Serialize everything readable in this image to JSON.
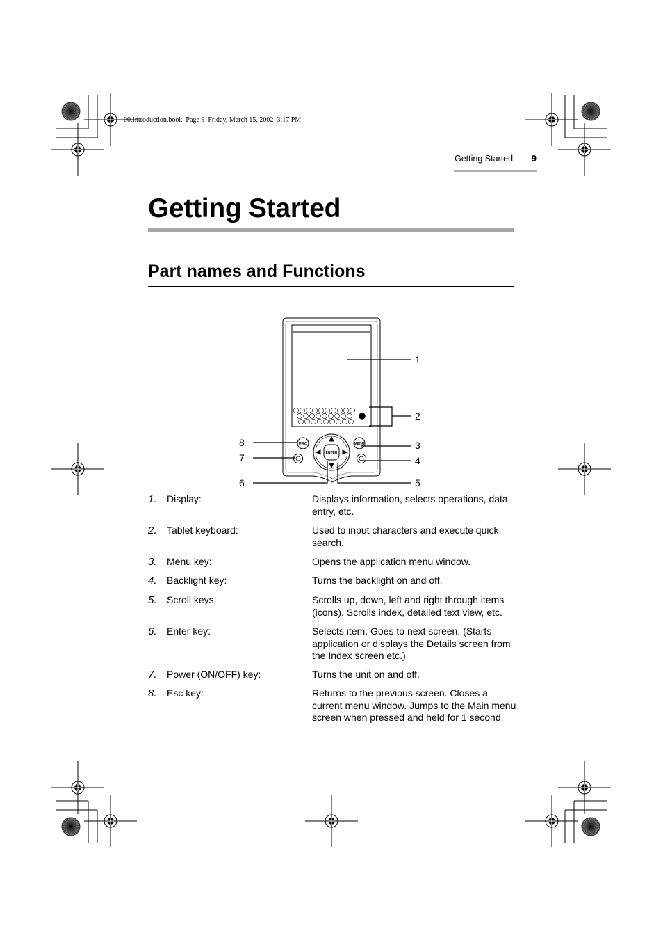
{
  "slug": "00.Introduction.book  Page 9  Friday, March 15, 2002  3:17 PM",
  "running_header": {
    "section": "Getting Started",
    "page_number": "9"
  },
  "title": "Getting Started",
  "subtitle": "Part names and Functions",
  "diagram": {
    "callouts": [
      "1",
      "2",
      "3",
      "4",
      "5",
      "6",
      "7",
      "8"
    ],
    "device_labels": {
      "esc": "ESC",
      "menu": "MENU",
      "enter": "ENTER"
    }
  },
  "items": [
    {
      "num": "1.",
      "label": "Display:",
      "desc": "Displays information, selects operations, data entry, etc."
    },
    {
      "num": "2.",
      "label": "Tablet keyboard:",
      "desc": "Used to input characters and execute quick search."
    },
    {
      "num": "3.",
      "label": "Menu key:",
      "desc": "Opens the application menu window."
    },
    {
      "num": "4.",
      "label": "Backlight key:",
      "desc": "Turns the backlight on and off."
    },
    {
      "num": "5.",
      "label": "Scroll keys:",
      "desc": "Scrolls up, down, left and right through items (icons). Scrolls index, detailed text view, etc."
    },
    {
      "num": "6.",
      "label": "Enter key:",
      "desc": "Selects item. Goes to next screen. (Starts application or displays the Details screen from the Index screen etc.)"
    },
    {
      "num": "7.",
      "label": "Power (ON/OFF) key:",
      "desc": "Turns the unit on and off."
    },
    {
      "num": "8.",
      "label": "Esc key:",
      "desc": "Returns to the previous screen. Closes a current menu window. Jumps to the Main menu screen when pressed and held for 1 second."
    }
  ]
}
